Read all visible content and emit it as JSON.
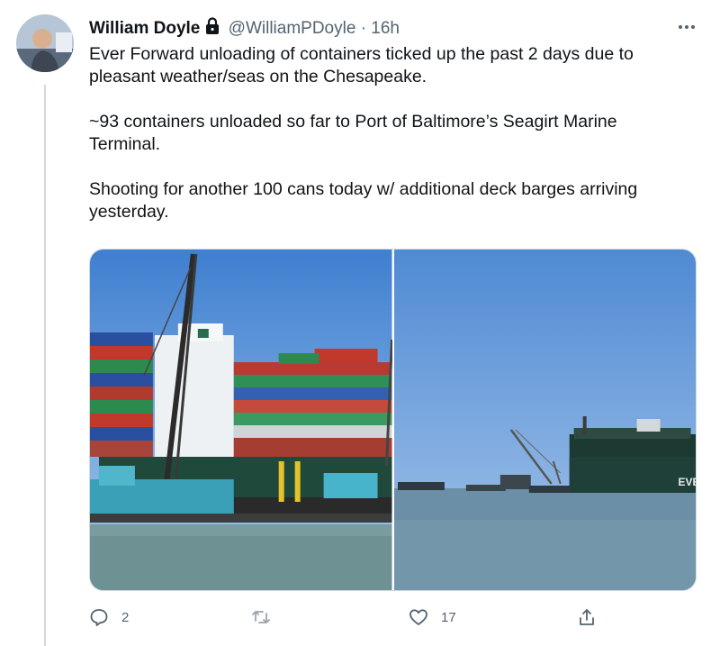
{
  "tweet": {
    "author_name": "William Doyle",
    "handle": "@WilliamPDoyle",
    "separator": "·",
    "time": "16h",
    "paragraphs": [
      "Ever Forward unloading of containers ticked up the past 2 days due to pleasant weather/seas on the Chesapeake.",
      "~93 containers unloaded so far to Port of Baltimore’s Seagirt Marine Terminal.",
      "Shooting for another 100 cans today w/ additional deck barges arriving yesterday."
    ],
    "photo_right_ship_text": "EVE"
  },
  "actions": {
    "reply_count": "2",
    "retweet_count": "",
    "like_count": "17"
  },
  "icons": {
    "lock": "lock-icon",
    "more": "more-icon",
    "reply": "reply-icon",
    "retweet": "retweet-icon",
    "like": "heart-icon",
    "share": "share-icon"
  },
  "colors": {
    "text": "#0f1419",
    "secondary": "#536471",
    "border": "#cfd9de"
  }
}
